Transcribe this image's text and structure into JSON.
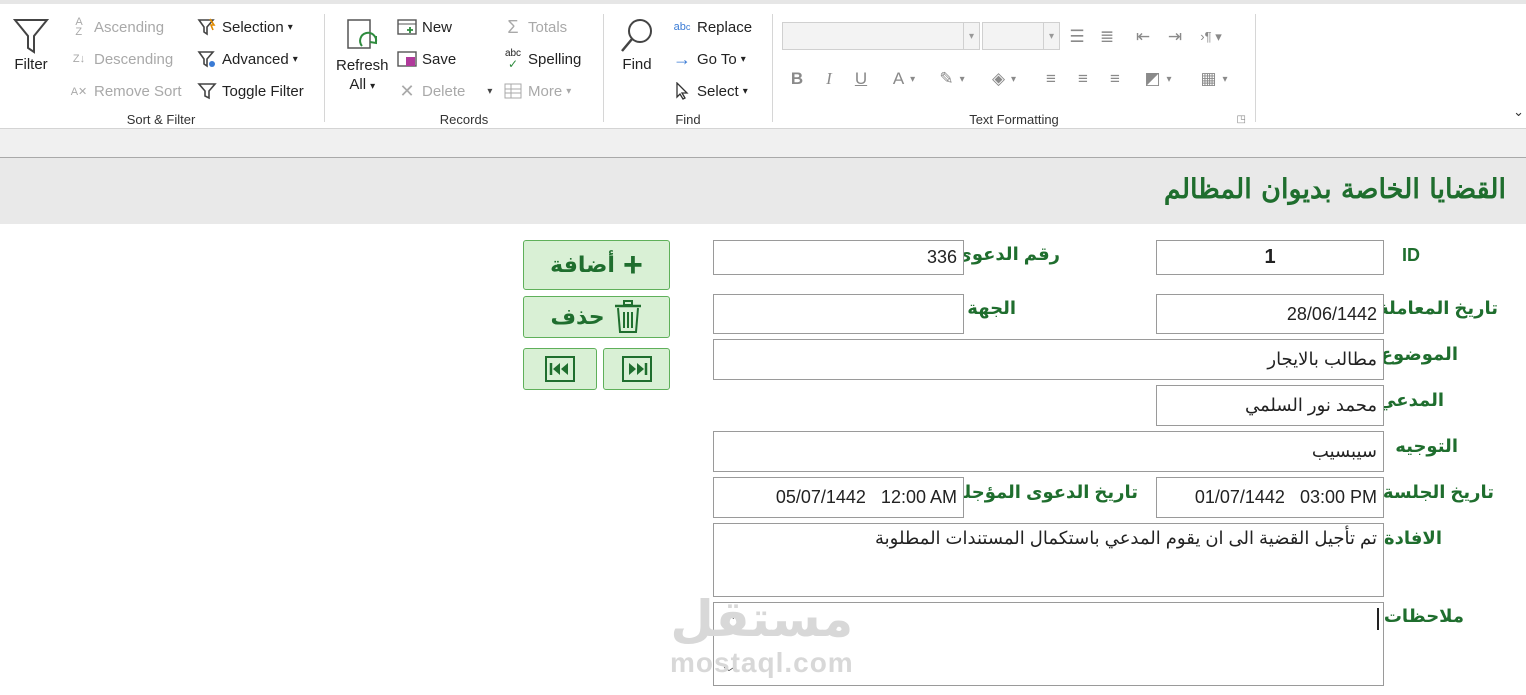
{
  "ribbon": {
    "sort_filter": {
      "filter": "Filter",
      "ascending": "Ascending",
      "descending": "Descending",
      "remove_sort": "Remove Sort",
      "selection": "Selection",
      "advanced": "Advanced",
      "toggle_filter": "Toggle Filter",
      "group_label": "Sort & Filter"
    },
    "records": {
      "refresh_line1": "Refresh",
      "refresh_line2": "All",
      "new": "New",
      "save": "Save",
      "delete": "Delete",
      "totals": "Totals",
      "spelling": "Spelling",
      "more": "More",
      "group_label": "Records"
    },
    "find": {
      "find": "Find",
      "replace": "Replace",
      "goto": "Go To",
      "select": "Select",
      "group_label": "Find"
    },
    "text_formatting": {
      "bold": "B",
      "italic": "I",
      "underline": "U",
      "group_label": "Text Formatting"
    }
  },
  "form": {
    "title": "القضايا الخاصة بديوان المظالم",
    "labels": {
      "id": "ID",
      "case_number": "رقم الدعوى",
      "transaction_date": "تاريخ المعاملة",
      "entity": "الجهة",
      "subject": "الموضوع",
      "plaintiff": "المدعي",
      "direction": "التوجيه",
      "session_date": "تاريخ الجلسة",
      "postponed_date": "تاريخ الدعوى المؤجلة",
      "statement": "الافادة",
      "notes": "ملاحظات"
    },
    "values": {
      "id": "1",
      "case_number": "336",
      "transaction_date": "28/06/1442",
      "entity": "",
      "subject": "مطالب بالايجار",
      "plaintiff": "محمد نور السلمي",
      "direction": "سيبسيب",
      "session_date": "01/07/1442   03:00 PM",
      "postponed_date": "05/07/1442   12:00 AM",
      "statement": "تم تأجيل القضية الى ان يقوم المدعي باستكمال المستندات المطلوبة",
      "notes": ""
    },
    "buttons": {
      "add": "أضافة",
      "delete": "حذف"
    }
  },
  "watermark": {
    "arabic": "مستقل",
    "latin": "mostaql.com"
  },
  "colors": {
    "accent_green": "#1f6e2e",
    "button_fill": "#d9f0d5",
    "button_border": "#5fb05a"
  }
}
